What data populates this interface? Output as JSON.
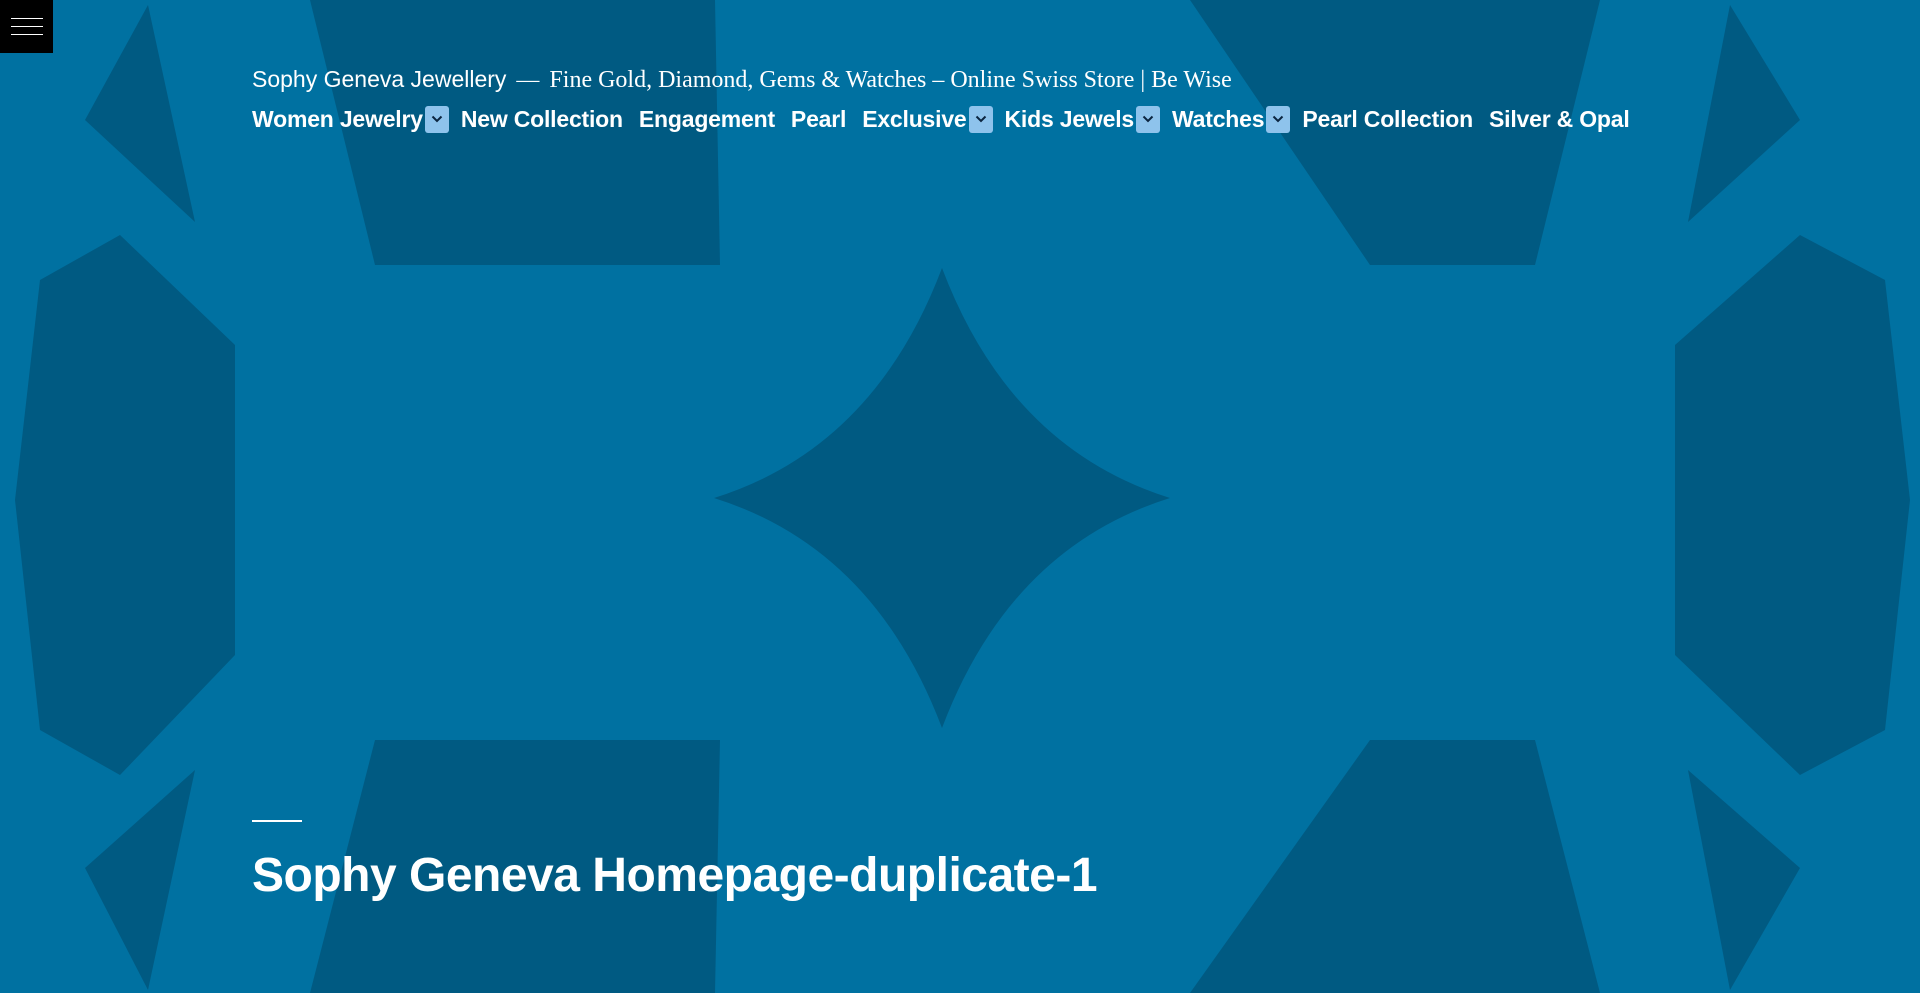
{
  "colors": {
    "background": "#0071a1",
    "pattern_dark": "#005a82",
    "submenu_toggle": "#8ec3ec",
    "text": "#ffffff",
    "menu_button": "#000000"
  },
  "menu_toggle": {
    "icon": "hamburger-menu-icon"
  },
  "header": {
    "site_title": "Sophy Geneva Jewellery",
    "separator": "—",
    "site_description": "Fine Gold, Diamond, Gems & Watches – Online Swiss Store | Be Wise"
  },
  "nav": {
    "items": [
      {
        "label": "Women Jewelry",
        "has_submenu": true
      },
      {
        "label": "New Collection",
        "has_submenu": false
      },
      {
        "label": "Engagement",
        "has_submenu": false
      },
      {
        "label": "Pearl",
        "has_submenu": false
      },
      {
        "label": "Exclusive",
        "has_submenu": true
      },
      {
        "label": "Kids Jewels",
        "has_submenu": true
      },
      {
        "label": "Watches",
        "has_submenu": true
      },
      {
        "label": "Pearl Collection",
        "has_submenu": false
      },
      {
        "label": "Silver & Opal",
        "has_submenu": false
      }
    ],
    "submenu_icon": "chevron-down-icon"
  },
  "page": {
    "title": "Sophy Geneva Homepage-duplicate-1"
  }
}
